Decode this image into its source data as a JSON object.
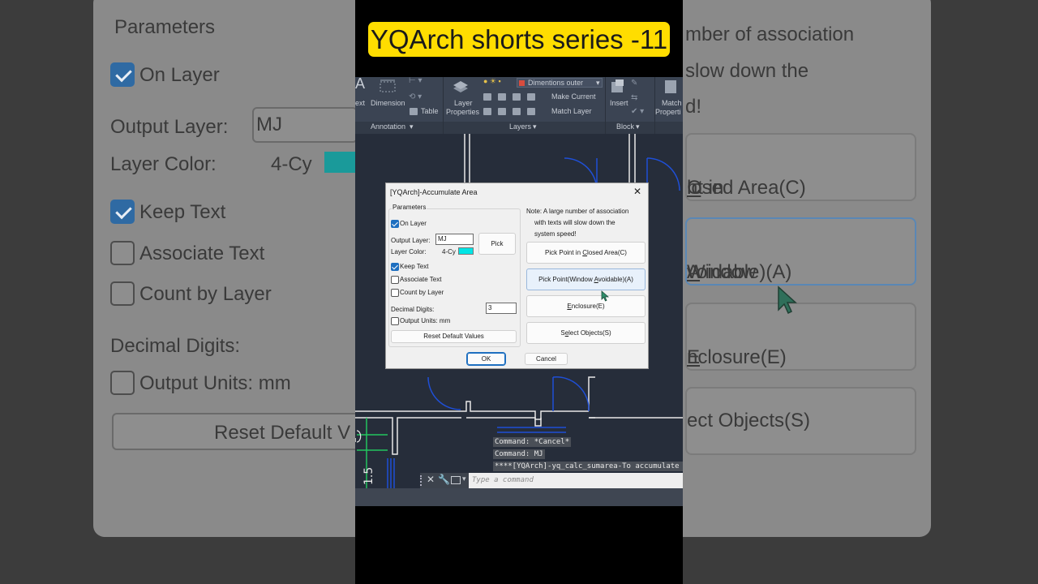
{
  "banner": {
    "text": "YQArch shorts series -11"
  },
  "background": {
    "params_title": "Parameters",
    "on_layer": "On Layer",
    "output_layer": "Output Layer:",
    "output_value": "MJ",
    "layer_color": "Layer Color:",
    "color_value": "4-Cy",
    "keep_text": "Keep Text",
    "associate_text": "Associate Text",
    "count_by_layer": "Count by Layer",
    "decimal_digits": "Decimal Digits:",
    "output_units": "Output Units: mm",
    "reset_partial": "Reset Default V",
    "note_line1": "mber of association",
    "note_line2": "slow down the",
    "note_line3": "d!",
    "btn1_partial": "nt in ",
    "btn1_key": "C",
    "btn1_rest": "losed Area(C)",
    "btn2_partial": "Window ",
    "btn2_key": "A",
    "btn2_rest": "voidable)(A)",
    "btn3_key": "E",
    "btn3_rest": "nclosure(E)",
    "btn4_partial": "ect Objects(S)"
  },
  "ribbon": {
    "text_tool": "ext",
    "dimension": "Dimension",
    "table": "Table",
    "layer_properties_1": "Layer",
    "layer_properties_2": "Properties",
    "layer_dropdown": "Dimentions outer",
    "make_current": "Make Current",
    "match_layer": "Match Layer",
    "insert": "Insert",
    "match_properties_1": "Match",
    "match_properties_2": "Properti",
    "panel_annotation": "Annotation",
    "panel_layers": "Layers",
    "panel_block": "Block",
    "dropdown_arrow": "▾"
  },
  "command": {
    "history1": "Command: *Cancel*",
    "history2": "Command: MJ",
    "history3": "****[YQArch]-yq_calc_sumarea-To accumulate a",
    "placeholder": "Type a command"
  },
  "dialog": {
    "title": "[YQArch]-Accumulate Area",
    "close": "✕",
    "params_title": "Parameters",
    "on_layer": {
      "label": "On Layer",
      "checked": true
    },
    "output_layer_label": "Output Layer:",
    "output_layer_value": "MJ",
    "pick": "Pick",
    "layer_color_label": "Layer Color:",
    "layer_color_value": "4-Cy",
    "layer_color_hex": "#00e5e5",
    "keep_text": {
      "label": "Keep Text",
      "checked": true
    },
    "associate_text": {
      "label": "Associate Text",
      "checked": false
    },
    "count_by_layer": {
      "label": "Count by Layer",
      "checked": false
    },
    "decimal_digits_label": "Decimal Digits:",
    "decimal_digits_value": "3",
    "output_units": {
      "label": "Output Units: mm",
      "checked": false
    },
    "reset": "Reset Default Values",
    "note_line1": "Note: A large number of association",
    "note_line2": "with texts will slow down the",
    "note_line3": "system speed!",
    "btn_closed_pre": "Pick Point in ",
    "btn_closed_key": "C",
    "btn_closed_post": "losed Area(C)",
    "btn_window_pre": "Pick Point(Window ",
    "btn_window_key": "A",
    "btn_window_post": "voidable)(A)",
    "btn_enclosure_key": "E",
    "btn_enclosure_post": "nclosure(E)",
    "btn_select_pre": "S",
    "btn_select_key": "e",
    "btn_select_post": "lect Objects(S)",
    "ok": "OK",
    "cancel": "Cancel"
  },
  "colors": {
    "banner": "#ffdd00",
    "drawing_bg": "#262d3a",
    "accent_blue": "#1e6fc0",
    "wall": "#ffffff",
    "door_arc": "#1f4fd6"
  }
}
